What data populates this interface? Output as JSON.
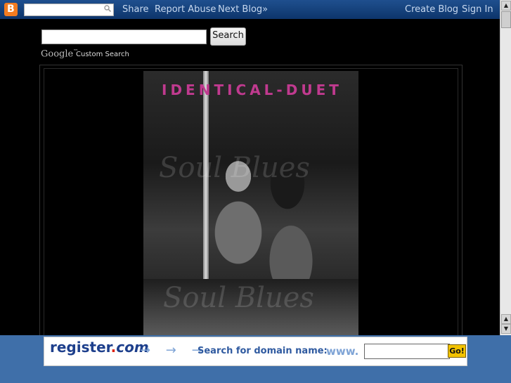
{
  "navbar": {
    "search_value": "",
    "links": {
      "share": "Share",
      "report_abuse": "Report Abuse",
      "next_blog": "Next Blog»",
      "create_blog": "Create Blog",
      "sign_in": "Sign In"
    }
  },
  "cse": {
    "input_value": "",
    "button": "Search",
    "google": "Google",
    "tm": "™",
    "custom_search": "Custom Search"
  },
  "blog": {
    "title": "IDENTICAL-DUET",
    "watermark_1": "Soul Blues",
    "watermark_2": "Soul Blues"
  },
  "banner": {
    "logo_register": "register",
    "logo_dot": ".",
    "logo_com": "com",
    "arrows": "→ → →",
    "label": "Search for domain name:",
    "www": "www.",
    "input_value": "",
    "go": "Go!"
  },
  "colors": {
    "navbar": "#0d356b",
    "title": "#c03a8f",
    "banner_band": "#3f6fa9",
    "go": "#f3c300"
  }
}
